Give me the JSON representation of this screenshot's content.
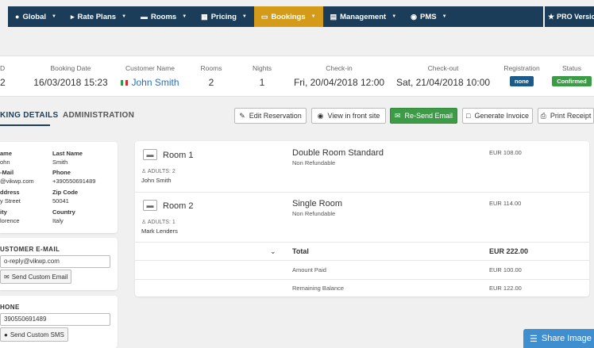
{
  "nav": {
    "items": [
      {
        "label": "Global",
        "icon": "globe-icon"
      },
      {
        "label": "Rate Plans",
        "icon": "tags-icon"
      },
      {
        "label": "Rooms",
        "icon": "bed-icon"
      },
      {
        "label": "Pricing",
        "icon": "grid-icon"
      },
      {
        "label": "Bookings",
        "icon": "credit-card-icon",
        "active": true
      },
      {
        "label": "Management",
        "icon": "chart-icon"
      },
      {
        "label": "PMS",
        "icon": "database-icon"
      }
    ],
    "pro_label": "PRO Version",
    "bar_color": "#1c3d5a",
    "active_color": "#d49b1a"
  },
  "summary": {
    "headers": {
      "id": "D",
      "booking_date": "Booking Date",
      "customer_name": "Customer Name",
      "rooms": "Rooms",
      "nights": "Nights",
      "checkin": "Check-in",
      "checkout": "Check-out",
      "registration": "Registration",
      "status": "Status"
    },
    "values": {
      "id": "2",
      "booking_date": "16/03/2018 15:23",
      "customer_name": "John Smith",
      "rooms": "2",
      "nights": "1",
      "checkin": "Fri, 20/04/2018 12:00",
      "checkout": "Sat, 21/04/2018 10:00",
      "registration": "none",
      "status": "Confirmed"
    },
    "registration_color": "#1c5a8a",
    "status_color": "#3d9b47"
  },
  "tabs": {
    "details": "KING DETAILS",
    "administration": "ADMINISTRATION"
  },
  "actions": {
    "edit": "Edit Reservation",
    "view": "View in front site",
    "resend": "Re-Send Email",
    "invoice": "Generate Invoice",
    "print": "Print Receipt"
  },
  "customer": {
    "first_name_label": "ame",
    "first_name": "ohn",
    "last_name_label": "Last Name",
    "last_name": "Smith",
    "email_label": "-Mail",
    "email": "@vikwp.com",
    "phone_label": "Phone",
    "phone": "+390550691489",
    "address_label": "ddress",
    "address": "y Street",
    "zip_label": "Zip Code",
    "zip": "50041",
    "city_label": "ity",
    "city": "lorence",
    "country_label": "Country",
    "country": "Italy"
  },
  "custom_email": {
    "title": "USTOMER E-MAIL",
    "value": "o-reply@vikwp.com",
    "button": "Send Custom Email"
  },
  "custom_sms": {
    "title": "HONE",
    "value": "390550691489",
    "button": "Send Custom SMS"
  },
  "rooms": [
    {
      "name": "Room 1",
      "adults": "ADULTS: 2",
      "guest": "John Smith",
      "type": "Double Room Standard",
      "plan": "Non Refundable",
      "price": "EUR 108.00"
    },
    {
      "name": "Room 2",
      "adults": "ADULTS: 1",
      "guest": "Mark Lenders",
      "type": "Single Room",
      "plan": "Non Refundable",
      "price": "EUR 114.00"
    }
  ],
  "totals": {
    "total_label": "Total",
    "total": "EUR 222.00",
    "paid_label": "Amount Paid",
    "paid": "EUR 100.00",
    "balance_label": "Remaining Balance",
    "balance": "EUR 122.00"
  },
  "share": {
    "label": "Share Image",
    "color": "#3e8ed0"
  }
}
